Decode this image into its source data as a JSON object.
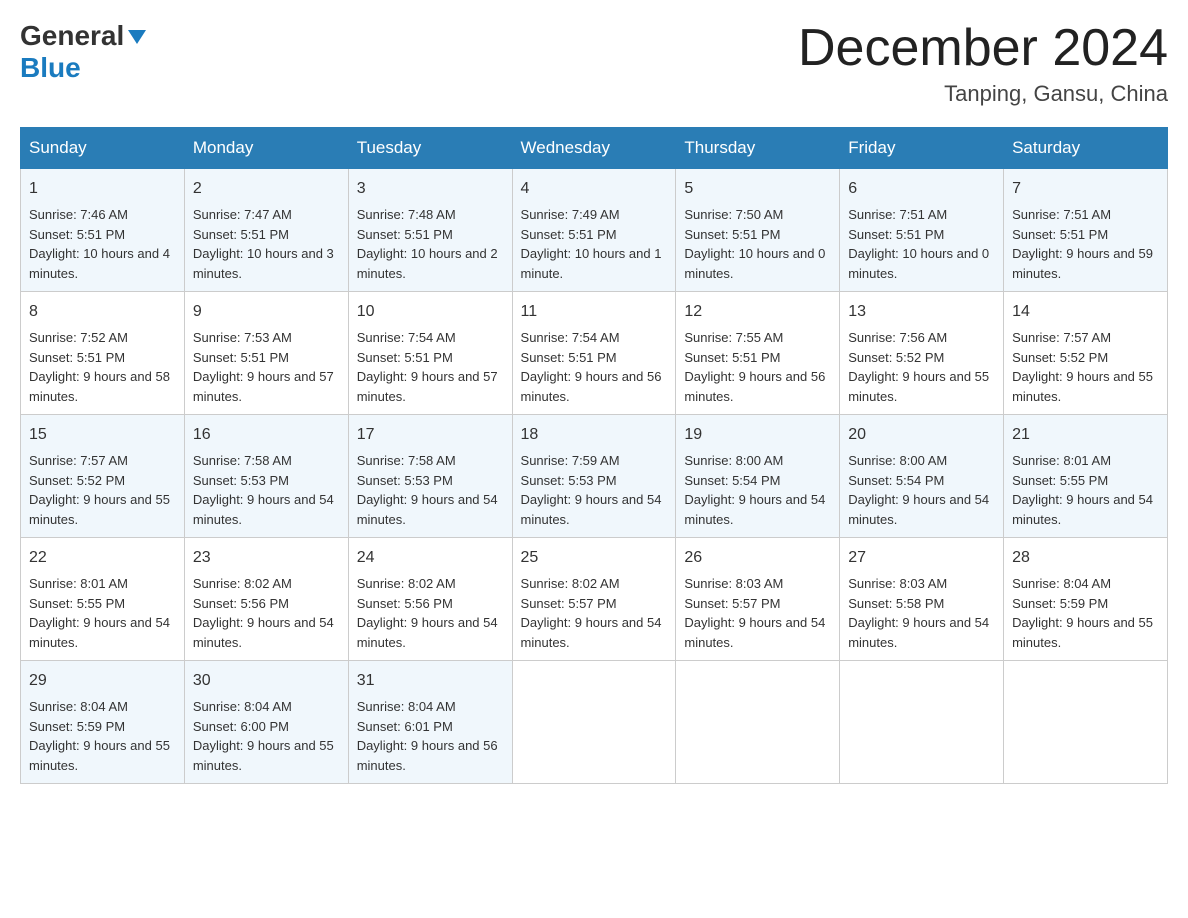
{
  "header": {
    "logo_general": "General",
    "logo_blue": "Blue",
    "month_title": "December 2024",
    "location": "Tanping, Gansu, China"
  },
  "weekdays": [
    "Sunday",
    "Monday",
    "Tuesday",
    "Wednesday",
    "Thursday",
    "Friday",
    "Saturday"
  ],
  "weeks": [
    [
      {
        "day": "1",
        "sunrise": "Sunrise: 7:46 AM",
        "sunset": "Sunset: 5:51 PM",
        "daylight": "Daylight: 10 hours and 4 minutes."
      },
      {
        "day": "2",
        "sunrise": "Sunrise: 7:47 AM",
        "sunset": "Sunset: 5:51 PM",
        "daylight": "Daylight: 10 hours and 3 minutes."
      },
      {
        "day": "3",
        "sunrise": "Sunrise: 7:48 AM",
        "sunset": "Sunset: 5:51 PM",
        "daylight": "Daylight: 10 hours and 2 minutes."
      },
      {
        "day": "4",
        "sunrise": "Sunrise: 7:49 AM",
        "sunset": "Sunset: 5:51 PM",
        "daylight": "Daylight: 10 hours and 1 minute."
      },
      {
        "day": "5",
        "sunrise": "Sunrise: 7:50 AM",
        "sunset": "Sunset: 5:51 PM",
        "daylight": "Daylight: 10 hours and 0 minutes."
      },
      {
        "day": "6",
        "sunrise": "Sunrise: 7:51 AM",
        "sunset": "Sunset: 5:51 PM",
        "daylight": "Daylight: 10 hours and 0 minutes."
      },
      {
        "day": "7",
        "sunrise": "Sunrise: 7:51 AM",
        "sunset": "Sunset: 5:51 PM",
        "daylight": "Daylight: 9 hours and 59 minutes."
      }
    ],
    [
      {
        "day": "8",
        "sunrise": "Sunrise: 7:52 AM",
        "sunset": "Sunset: 5:51 PM",
        "daylight": "Daylight: 9 hours and 58 minutes."
      },
      {
        "day": "9",
        "sunrise": "Sunrise: 7:53 AM",
        "sunset": "Sunset: 5:51 PM",
        "daylight": "Daylight: 9 hours and 57 minutes."
      },
      {
        "day": "10",
        "sunrise": "Sunrise: 7:54 AM",
        "sunset": "Sunset: 5:51 PM",
        "daylight": "Daylight: 9 hours and 57 minutes."
      },
      {
        "day": "11",
        "sunrise": "Sunrise: 7:54 AM",
        "sunset": "Sunset: 5:51 PM",
        "daylight": "Daylight: 9 hours and 56 minutes."
      },
      {
        "day": "12",
        "sunrise": "Sunrise: 7:55 AM",
        "sunset": "Sunset: 5:51 PM",
        "daylight": "Daylight: 9 hours and 56 minutes."
      },
      {
        "day": "13",
        "sunrise": "Sunrise: 7:56 AM",
        "sunset": "Sunset: 5:52 PM",
        "daylight": "Daylight: 9 hours and 55 minutes."
      },
      {
        "day": "14",
        "sunrise": "Sunrise: 7:57 AM",
        "sunset": "Sunset: 5:52 PM",
        "daylight": "Daylight: 9 hours and 55 minutes."
      }
    ],
    [
      {
        "day": "15",
        "sunrise": "Sunrise: 7:57 AM",
        "sunset": "Sunset: 5:52 PM",
        "daylight": "Daylight: 9 hours and 55 minutes."
      },
      {
        "day": "16",
        "sunrise": "Sunrise: 7:58 AM",
        "sunset": "Sunset: 5:53 PM",
        "daylight": "Daylight: 9 hours and 54 minutes."
      },
      {
        "day": "17",
        "sunrise": "Sunrise: 7:58 AM",
        "sunset": "Sunset: 5:53 PM",
        "daylight": "Daylight: 9 hours and 54 minutes."
      },
      {
        "day": "18",
        "sunrise": "Sunrise: 7:59 AM",
        "sunset": "Sunset: 5:53 PM",
        "daylight": "Daylight: 9 hours and 54 minutes."
      },
      {
        "day": "19",
        "sunrise": "Sunrise: 8:00 AM",
        "sunset": "Sunset: 5:54 PM",
        "daylight": "Daylight: 9 hours and 54 minutes."
      },
      {
        "day": "20",
        "sunrise": "Sunrise: 8:00 AM",
        "sunset": "Sunset: 5:54 PM",
        "daylight": "Daylight: 9 hours and 54 minutes."
      },
      {
        "day": "21",
        "sunrise": "Sunrise: 8:01 AM",
        "sunset": "Sunset: 5:55 PM",
        "daylight": "Daylight: 9 hours and 54 minutes."
      }
    ],
    [
      {
        "day": "22",
        "sunrise": "Sunrise: 8:01 AM",
        "sunset": "Sunset: 5:55 PM",
        "daylight": "Daylight: 9 hours and 54 minutes."
      },
      {
        "day": "23",
        "sunrise": "Sunrise: 8:02 AM",
        "sunset": "Sunset: 5:56 PM",
        "daylight": "Daylight: 9 hours and 54 minutes."
      },
      {
        "day": "24",
        "sunrise": "Sunrise: 8:02 AM",
        "sunset": "Sunset: 5:56 PM",
        "daylight": "Daylight: 9 hours and 54 minutes."
      },
      {
        "day": "25",
        "sunrise": "Sunrise: 8:02 AM",
        "sunset": "Sunset: 5:57 PM",
        "daylight": "Daylight: 9 hours and 54 minutes."
      },
      {
        "day": "26",
        "sunrise": "Sunrise: 8:03 AM",
        "sunset": "Sunset: 5:57 PM",
        "daylight": "Daylight: 9 hours and 54 minutes."
      },
      {
        "day": "27",
        "sunrise": "Sunrise: 8:03 AM",
        "sunset": "Sunset: 5:58 PM",
        "daylight": "Daylight: 9 hours and 54 minutes."
      },
      {
        "day": "28",
        "sunrise": "Sunrise: 8:04 AM",
        "sunset": "Sunset: 5:59 PM",
        "daylight": "Daylight: 9 hours and 55 minutes."
      }
    ],
    [
      {
        "day": "29",
        "sunrise": "Sunrise: 8:04 AM",
        "sunset": "Sunset: 5:59 PM",
        "daylight": "Daylight: 9 hours and 55 minutes."
      },
      {
        "day": "30",
        "sunrise": "Sunrise: 8:04 AM",
        "sunset": "Sunset: 6:00 PM",
        "daylight": "Daylight: 9 hours and 55 minutes."
      },
      {
        "day": "31",
        "sunrise": "Sunrise: 8:04 AM",
        "sunset": "Sunset: 6:01 PM",
        "daylight": "Daylight: 9 hours and 56 minutes."
      },
      null,
      null,
      null,
      null
    ]
  ]
}
